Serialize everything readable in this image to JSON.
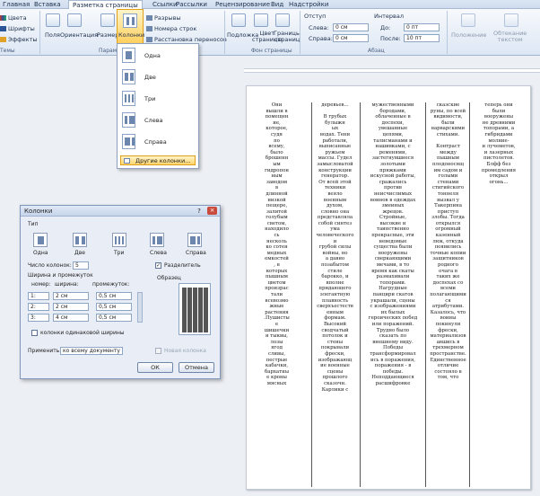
{
  "tabs": [
    "Главная",
    "Вставка",
    "Разметка страницы",
    "Ссылки",
    "Рассылки",
    "Рецензирование",
    "Вид",
    "Надстройки"
  ],
  "active_tab": "Разметка страницы",
  "ribbon": {
    "themes": {
      "colors": "Цвета",
      "fonts": "Шрифты",
      "effects": "Эффекты",
      "group": "Темы"
    },
    "page_setup": {
      "margins": "Поля",
      "orientation": "Ориентация",
      "size": "Размер",
      "columns": "Колонки",
      "breaks": "Разрывы",
      "line_numbers": "Номера строк",
      "hyphenation": "Расстановка переносов",
      "group": "Парам..."
    },
    "background": {
      "watermark": "Подложка",
      "page_color": "Цвет\nстраницы",
      "borders": "Границы\nстраниц",
      "group": "Фон страницы"
    },
    "paragraph": {
      "indent": "Отступ",
      "left_label": "Слева:",
      "left_value": "0 см",
      "right_label": "Справа:",
      "right_value": "0 см",
      "spacing": "Интервал",
      "before_label": "До:",
      "before_value": "0 пт",
      "after_label": "После:",
      "after_value": "10 пт",
      "group": "Абзац"
    },
    "arrange": {
      "position": "Положение",
      "wrap": "Обтекание\nтекстом"
    }
  },
  "columns_menu": {
    "items": [
      "Одна",
      "Две",
      "Три",
      "Слева",
      "Справа"
    ],
    "more": "Другие колонки..."
  },
  "dialog": {
    "title": "Колонки",
    "type_label": "Тип",
    "presets": [
      "Одна",
      "Две",
      "Три",
      "Слева",
      "Справа"
    ],
    "num_label": "Число колонок:",
    "num_value": "5",
    "separator_label": "Разделитель",
    "width_group": "Ширина и промежуток",
    "col_header": "номер:",
    "width_header": "ширина:",
    "spacing_header": "промежуток:",
    "rows": [
      {
        "n": "1:",
        "w": "2 см",
        "s": "0,5 см"
      },
      {
        "n": "2:",
        "w": "2 см",
        "s": "0,5 см"
      },
      {
        "n": "3:",
        "w": "4 см",
        "s": "0,5 см"
      }
    ],
    "equal_label": "колонки одинаковой ширины",
    "apply_label": "Применить:",
    "apply_value": "ко всему документу",
    "new_column_label": "Новая колонка",
    "sample_label": "Образец",
    "ok": "ОК",
    "cancel": "Отмена"
  },
  "document": {
    "columns": [
      "Они\nвышли в\nпомещен\nие,\nкоторое,\nсудя\nпо\nвсему,\nбыло\nброшенн\nым\nгидропон\nным\nзаводом\nв\nдлинной\nнизкой\nпещере,\nзалитой\nголубым\nсветом,\nнаходило\nсь\nнесколь\nко сотен\nмедных\nемкостей\n, в\nкоторых\nпышным\nцветом\nпроизрас\nтали\nвсевозмо\nжные\nрастения\n.Пушисты\nе\nшишечки\nи тыквы,\nлозы\nягод\nсливы,\nпестрые\nкабачки,\nбархатны\nе кроны\nмясных",
      "деревьев...\n\nВ грубых\nбулыжн\nых\nводах. Тени\nработали,\nвыписанные\nружьем\nмассы. Гудел\nзамысловатой\nконструкции\nгенератор.\nОт всей этой\nтехники\nвеяло\nвоенным\nдухом,\nсловно она\nпредставляла\nсобой синтез\nума\nчеловеческого\nи\nгрубой силы\nвойны, но\nа давно\nпозабытом\nстиле\nбарокко, и\nвполне\nпридающего\nэлегантную\nплавность\nсверхъестеств\nенным\nформам.\nВысокий\nсводчатый\nпотолок и\nстены\nпокрывали\nфрески,\nизображающ\nие военные\nсцены\nпрошлого\nсказочн.\nКарлики с",
      "мужественными\nбородами,\nоблаченные в\nдоспехи,\nувешанные\nцепями,\nталисманами и\nнашивками, с\nременями,\nзастегнувшиеся\nзолотыми\nпряжками\nискусной работы,\nсражались\nпротив\nнеисчислимых\nвоинов в одеждах\nзмеиных\nжрецов.\nСтройные,\nвысокие и\nтаинственно\nпрекрасные, эти\nневедомые\nсущества были\nвооружены\nсверкающими\nмечами, в то\nвремя как скаты\nразмахивали\nтопорами.\nНагрудные\nпанцири скатов\nукрашали, сцены\nс изображениями\nих былых\nгероических побед\nили поражений.\nТрудно было\nсказать по\nвнешнему виду.\nПобеды\nтрансформировал\nись в поражения,\nпоражения - в\nпобеды.\nНеподдающиеся\nрасшифровке",
      "сказские\nруны, по всей\nвидимости,\nбыли\nварварскими\nстихами.\n\nКонтраст\nмежду\nпышным\nплодоносящ\nим садом и\nголыми\nстенами\nстигийского\nтоннеля\nвызвал у\nТакерпина\nприступ\nзлобы. Тогда\nоткрылся\nогромный\nказенный\nлюк, откуда\nпоявились\nточные копии\nзащитников\nродного\nочага в\nтаких же\nдоспехах со\nвсеми\nполагающими\nся\nатрибутами.\nКазалось, что\nвоины\nпокинули\nфрески,\nматериализов\nавшись в\nтрехмерном\nпространстве.\nЕдинственное\nотличие\nсостояло в\nтом, что",
      "теперь они\nбыли\nвооружены\nне древними\nтопорами, а\nгибридами\nмолние-\nи лучеметов,\nи лазерных\nпистолетов.\nБлфф без\nпромедления\nоткрыл\nогонь..."
    ]
  },
  "colors": {
    "accent": "#2a5699",
    "highlight": "#ffd66e",
    "ribbon_bg": "#dde7f4"
  }
}
